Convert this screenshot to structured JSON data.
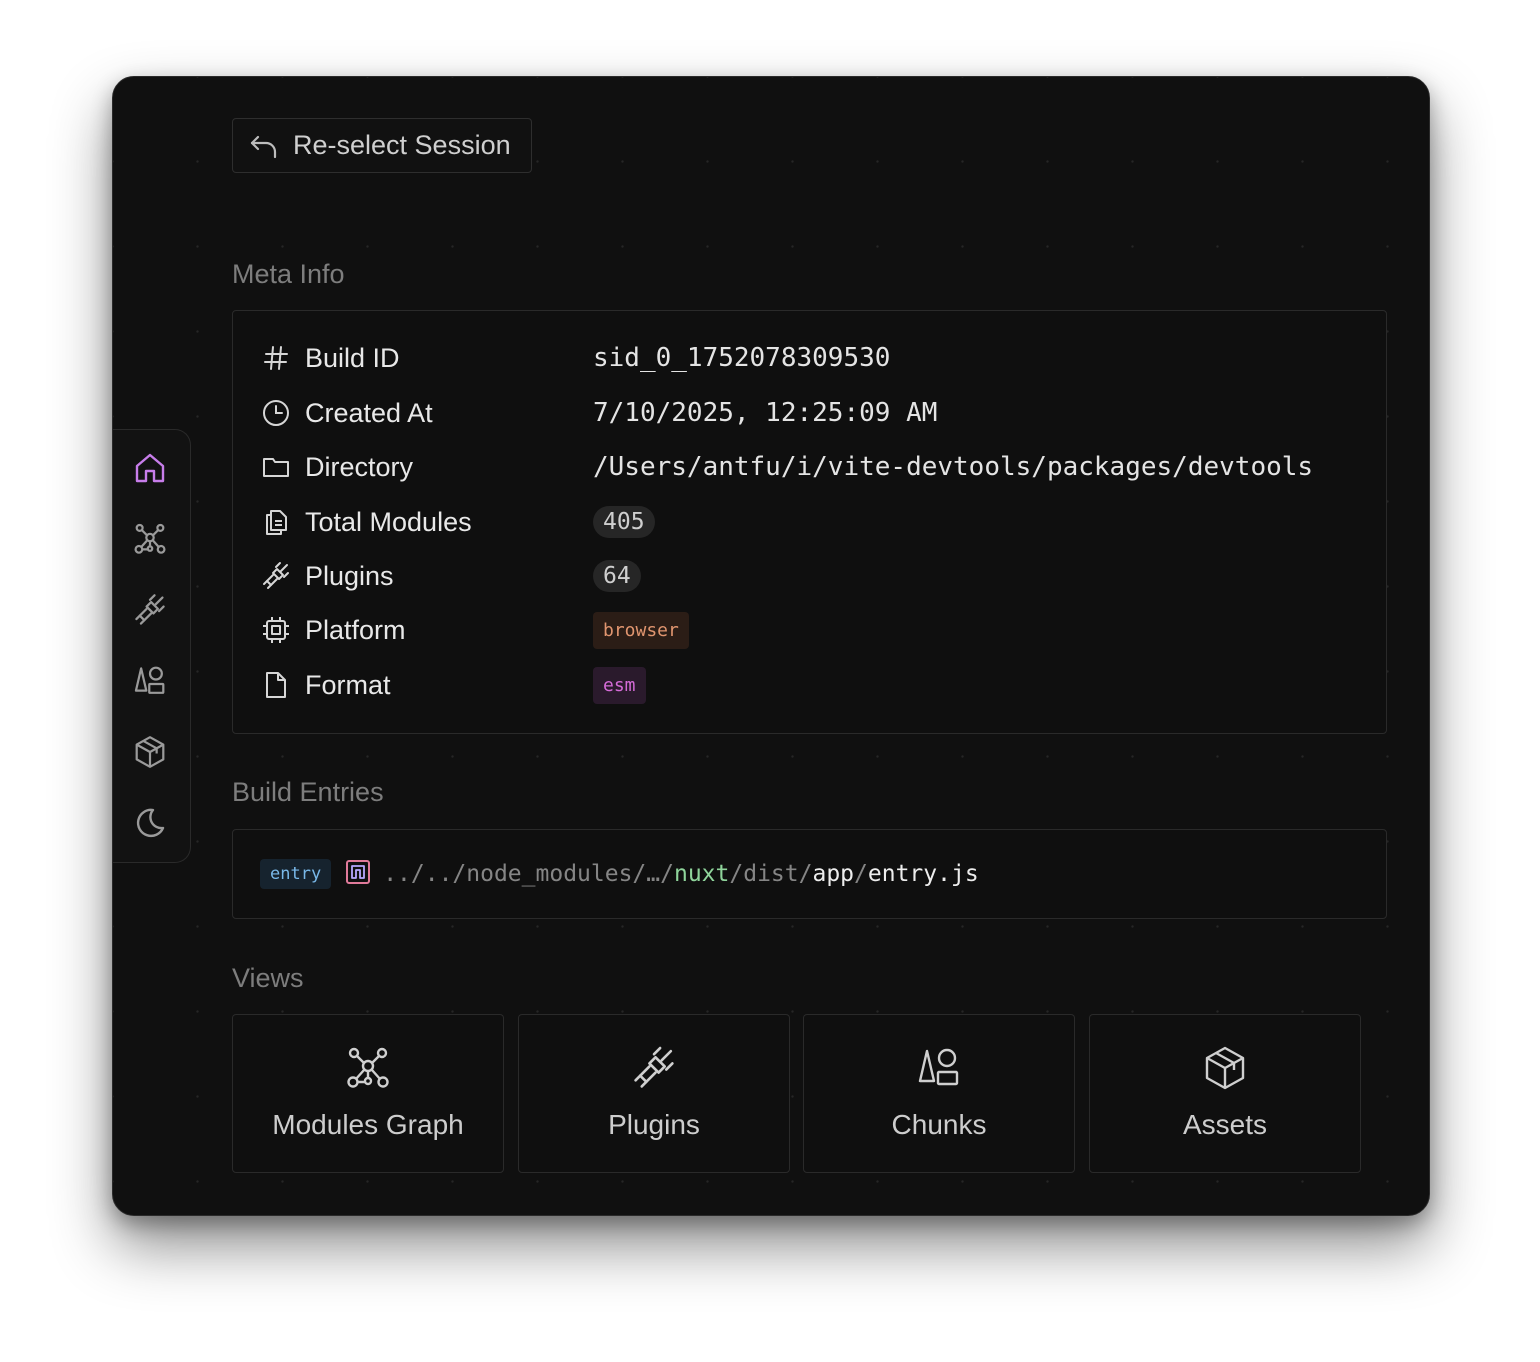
{
  "header": {
    "reselect_label": "Re-select Session"
  },
  "sections": {
    "meta_title": "Meta Info",
    "entries_title": "Build Entries",
    "views_title": "Views"
  },
  "meta": {
    "build_id": {
      "label": "Build ID",
      "value": "sid_0_1752078309530",
      "icon": "hash-icon"
    },
    "created_at": {
      "label": "Created At",
      "value": "7/10/2025, 12:25:09 AM",
      "icon": "clock-icon"
    },
    "directory": {
      "label": "Directory",
      "value": "/Users/antfu/i/vite-devtools/packages/devtools",
      "icon": "folder-icon"
    },
    "total_modules": {
      "label": "Total Modules",
      "value": "405",
      "icon": "files-icon"
    },
    "plugins": {
      "label": "Plugins",
      "value": "64",
      "icon": "plug-icon"
    },
    "platform": {
      "label": "Platform",
      "value": "browser",
      "icon": "cpu-icon"
    },
    "format": {
      "label": "Format",
      "value": "esm",
      "icon": "file-icon"
    }
  },
  "entries": [
    {
      "badge": "entry",
      "icon": "nuxt-logo-icon",
      "path_prefix": "../../node_modules/…/",
      "pkg": "nuxt",
      "sep1": "/",
      "dist": "dist",
      "sep2": "/",
      "dir": "app",
      "sep3": "/",
      "file": "entry.js"
    }
  ],
  "views": [
    {
      "label": "Modules Graph",
      "icon": "graph-icon"
    },
    {
      "label": "Plugins",
      "icon": "plug-icon"
    },
    {
      "label": "Chunks",
      "icon": "shapes-icon"
    },
    {
      "label": "Assets",
      "icon": "package-icon"
    }
  ],
  "sidebar": [
    {
      "name": "home",
      "icon": "home-icon",
      "active": true
    },
    {
      "name": "graph",
      "icon": "graph-icon"
    },
    {
      "name": "plugins",
      "icon": "plug-icon"
    },
    {
      "name": "chunks",
      "icon": "shapes-icon"
    },
    {
      "name": "assets",
      "icon": "package-icon"
    },
    {
      "name": "theme",
      "icon": "moon-icon"
    }
  ],
  "colors": {
    "accent": "#c77dea",
    "background": "#101010",
    "browser_badge": "#e0956f",
    "esm_badge": "#d46bd7",
    "entry_badge": "#79b8e8",
    "nuxt_green": "#8fd49b"
  }
}
